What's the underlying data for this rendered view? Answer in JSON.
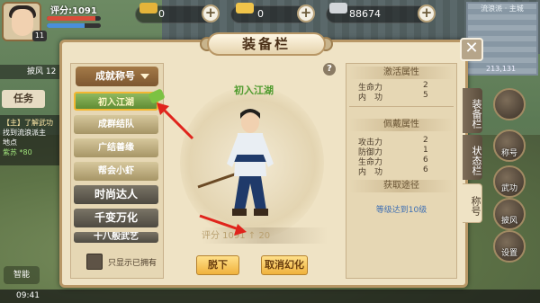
{
  "hud": {
    "score_label": "评分:1091",
    "level": "11",
    "hp_fill": 0.9,
    "mp_fill": 0.7,
    "resources": [
      {
        "name": "gem-icon",
        "value": "0",
        "color": "#e4b43a"
      },
      {
        "name": "gold-bar-icon",
        "value": "0",
        "color": "#f0c44a"
      },
      {
        "name": "silver-icon",
        "value": "88674",
        "color": "#d2d6da"
      }
    ],
    "plus_label": "+",
    "minimap_title": "流浪派 · 主城",
    "minimap_coord": "213,131",
    "left_panel_text": "披风 12",
    "task_tab": "任务",
    "quest_lines": [
      "【主】了解武功",
      "找到流浪派主",
      "地点",
      "紫苏 *80"
    ],
    "time": "09:41",
    "bottom_btn": "智能",
    "side_buttons": [
      "称号",
      "武功",
      "披风",
      "设置"
    ]
  },
  "window": {
    "title": "装备栏",
    "close_label": "✕",
    "help_label": "?",
    "dropdown_label": "成就称号",
    "title_list": [
      {
        "label": "初入江湖",
        "style": "t-selected"
      },
      {
        "label": "成群结队",
        "style": "t-green"
      },
      {
        "label": "广结善缘",
        "style": "t-green"
      },
      {
        "label": "帮会小虾",
        "style": "t-green"
      },
      {
        "label": "时尚达人",
        "style": "t-dark"
      },
      {
        "label": "千变万化",
        "style": "t-dark"
      },
      {
        "label": "十八般武艺",
        "style": "t-dark"
      }
    ],
    "checkbox_label": "只显示已拥有",
    "current_title": "初入江湖",
    "power_text": "评分 1091  ↑ 20",
    "btn_remove": "脱下",
    "btn_cancel": "取消幻化",
    "tabs": [
      {
        "label": "装备栏",
        "style": "dark"
      },
      {
        "label": "状态栏",
        "style": "dark"
      },
      {
        "label": "称号",
        "style": "light"
      }
    ],
    "activate_header": "激活属性",
    "activate_attrs": [
      {
        "name": "生命力",
        "value": "2"
      },
      {
        "name": "内　功",
        "value": "5"
      }
    ],
    "wear_header": "佩戴属性",
    "wear_attrs": [
      {
        "name": "攻击力",
        "value": "2"
      },
      {
        "name": "防御力",
        "value": "1"
      },
      {
        "name": "生命力",
        "value": "6"
      },
      {
        "name": "内　功",
        "value": "6"
      }
    ],
    "source_header": "获取途径",
    "source_text": "等级达到10级"
  }
}
